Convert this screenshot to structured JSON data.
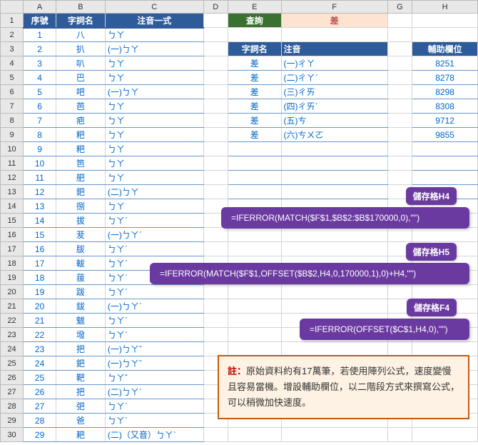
{
  "cols": [
    "",
    "A",
    "B",
    "C",
    "D",
    "E",
    "F",
    "G",
    "H"
  ],
  "headers": {
    "seq": "序號",
    "word": "字詞名",
    "phon": "注音一式",
    "query": "查詢",
    "result": "差",
    "f_word": "字詞名",
    "f_phon": "注音",
    "aux": "輔助欄位"
  },
  "rows": [
    {
      "n": 1,
      "a": "1",
      "b": "八",
      "c": "ㄅㄚ"
    },
    {
      "n": 2,
      "a": "2",
      "b": "扒",
      "c": "(一)ㄅㄚ"
    },
    {
      "n": 3,
      "a": "3",
      "b": "叭",
      "c": "ㄅㄚ"
    },
    {
      "n": 4,
      "a": "4",
      "b": "巴",
      "c": "ㄅㄚ"
    },
    {
      "n": 5,
      "a": "5",
      "b": "吧",
      "c": "(一)ㄅㄚ"
    },
    {
      "n": 6,
      "a": "6",
      "b": "芭",
      "c": "ㄅㄚ"
    },
    {
      "n": 7,
      "a": "7",
      "b": "疤",
      "c": "ㄅㄚ"
    },
    {
      "n": 8,
      "a": "8",
      "b": "粑",
      "c": "ㄅㄚ"
    },
    {
      "n": 9,
      "a": "9",
      "b": "粑",
      "c": "ㄅㄚ"
    },
    {
      "n": 10,
      "a": "10",
      "b": "笆",
      "c": "ㄅㄚ"
    },
    {
      "n": 11,
      "a": "11",
      "b": "舥",
      "c": "ㄅㄚ"
    },
    {
      "n": 12,
      "a": "12",
      "b": "鈀",
      "c": "(二)ㄅㄚ"
    },
    {
      "n": 13,
      "a": "13",
      "b": "捌",
      "c": "ㄅㄚ"
    },
    {
      "n": 14,
      "a": "14",
      "b": "拔",
      "c": "ㄅㄚˊ"
    },
    {
      "n": 15,
      "a": "15",
      "b": "茇",
      "c": "(一)ㄅㄚˊ"
    },
    {
      "n": 16,
      "a": "16",
      "b": "胈",
      "c": "ㄅㄚˊ"
    },
    {
      "n": 17,
      "a": "17",
      "b": "軷",
      "c": "ㄅㄚˊ"
    },
    {
      "n": 18,
      "a": "18",
      "b": "菝",
      "c": "ㄅㄚˊ"
    },
    {
      "n": 19,
      "a": "19",
      "b": "跋",
      "c": "ㄅㄚˊ"
    },
    {
      "n": 20,
      "a": "20",
      "b": "鈸",
      "c": "(一)ㄅㄚˊ"
    },
    {
      "n": 21,
      "a": "21",
      "b": "魃",
      "c": "ㄅㄚˊ"
    },
    {
      "n": 22,
      "a": "22",
      "b": "墢",
      "c": "ㄅㄚˊ"
    },
    {
      "n": 23,
      "a": "23",
      "b": "把",
      "c": "(一)ㄅㄚˇ"
    },
    {
      "n": 24,
      "a": "24",
      "b": "鈀",
      "c": "(一)ㄅㄚˇ"
    },
    {
      "n": 25,
      "a": "25",
      "b": "靶",
      "c": "ㄅㄚˇ"
    },
    {
      "n": 26,
      "a": "26",
      "b": "把",
      "c": "(二)ㄅㄚˋ"
    },
    {
      "n": 27,
      "a": "27",
      "b": "弝",
      "c": "ㄅㄚˋ"
    },
    {
      "n": 28,
      "a": "28",
      "b": "爸",
      "c": "ㄅㄚˋ"
    },
    {
      "n": 29,
      "a": "29",
      "b": "耙",
      "c": "(二)（又音）ㄅㄚˋ"
    }
  ],
  "results": [
    {
      "w": "差",
      "p": "(一)ㄔㄚ",
      "h": "8251"
    },
    {
      "w": "差",
      "p": "(二)ㄔㄚˊ",
      "h": "8278"
    },
    {
      "w": "差",
      "p": "(三)ㄔㄞ",
      "h": "8298"
    },
    {
      "w": "差",
      "p": "(四)ㄔㄞˋ",
      "h": "8308"
    },
    {
      "w": "差",
      "p": "(五)ㄘ",
      "h": "9712"
    },
    {
      "w": "差",
      "p": "(六)ㄘㄨㄛ",
      "h": "9855"
    }
  ],
  "labels": {
    "h4": "儲存格H4",
    "h5": "儲存格H5",
    "f4": "儲存格F4"
  },
  "formulas": {
    "h4": "=IFERROR(MATCH($F$1,$B$2:$B$170000,0),\"\")",
    "h5": "=IFERROR(MATCH($F$1,OFFSET($B$2,H4,0,170000,1),0)+H4,\"\")",
    "f4": "=IFERROR(OFFSET($C$1,H4,0),\"\")"
  },
  "note": {
    "pre": "註：",
    "text": "原始資料約有17萬筆，若使用陣列公式，速度變慢且容易當機。增設輔助欄位，以二階段方式來撰寫公式，可以稍微加快速度。"
  }
}
